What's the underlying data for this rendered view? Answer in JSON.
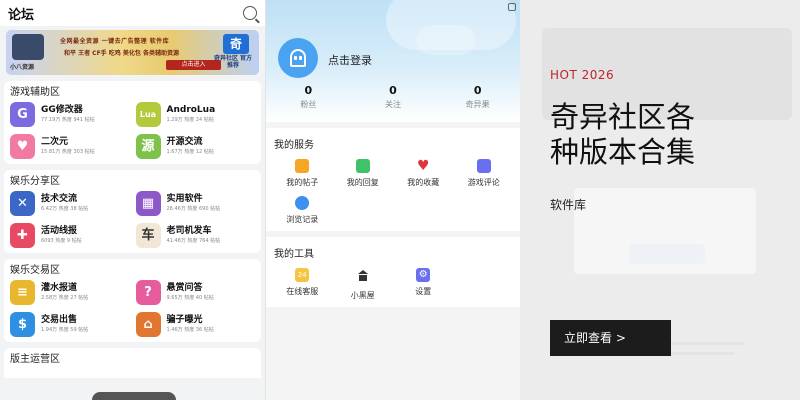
{
  "forum": {
    "title": "论坛",
    "banner": {
      "left_caption": "小八资源",
      "mid_line1": "全网最全资源  一键去广告整理  软件库",
      "mid_line2": "和平  王者  CF手  吃鸡  美化包  各类辅助资源",
      "button": "点击进入",
      "right_logo": "奇",
      "right_caption": "奇异社区 官方推荐"
    },
    "sections": [
      {
        "title": "游戏辅助区",
        "items": [
          {
            "name": "GG修改器",
            "stats": "77.19万 热度  941 帖帖",
            "color": "#7b6be0",
            "glyph": "G"
          },
          {
            "name": "AndroLua",
            "stats": "1.29万 热度  24 帖帖",
            "color": "#b4c93c",
            "glyph": "Lua"
          },
          {
            "name": "二次元",
            "stats": "15.81万 热度  303 帖帖",
            "color": "#f27aa2",
            "glyph": "♥"
          },
          {
            "name": "开源交流",
            "stats": "1.67万 热度  12 帖帖",
            "color": "#7dc24a",
            "glyph": "源"
          }
        ]
      },
      {
        "title": "娱乐分享区",
        "items": [
          {
            "name": "技术交流",
            "stats": "6.42万 热度  38 帖帖",
            "color": "#3b67c7",
            "glyph": "✕"
          },
          {
            "name": "实用软件",
            "stats": "28.46万 热度  690 帖帖",
            "color": "#8d58c8",
            "glyph": "▦"
          },
          {
            "name": "活动线报",
            "stats": "6093 热度  9 帖帖",
            "color": "#e84a64",
            "glyph": "✚"
          },
          {
            "name": "老司机发车",
            "stats": "41.48万 热度  764 帖帖",
            "color": "#f2e6d6",
            "glyph": "车"
          }
        ]
      },
      {
        "title": "娱乐交易区",
        "items": [
          {
            "name": "灌水报道",
            "stats": "2.58万 热度  27 帖帖",
            "color": "#e8b72e",
            "glyph": "≡"
          },
          {
            "name": "悬赏问答",
            "stats": "9.65万 热度  40 帖帖",
            "color": "#e65c9c",
            "glyph": "?"
          },
          {
            "name": "交易出售",
            "stats": "1.94万 热度  59 帖帖",
            "color": "#2f8fe0",
            "glyph": "$"
          },
          {
            "name": "骗子曝光",
            "stats": "1.46万 热度  36 帖帖",
            "color": "#e0762f",
            "glyph": "⌂"
          }
        ]
      }
    ],
    "last_section": "版主运营区"
  },
  "profile": {
    "login": "点击登录",
    "stats": [
      {
        "value": "0",
        "label": "粉丝"
      },
      {
        "value": "0",
        "label": "关注"
      },
      {
        "value": "0",
        "label": "奇异果"
      }
    ],
    "services_title": "我的服务",
    "services": [
      {
        "label": "我的帖子",
        "color": "#f5a623"
      },
      {
        "label": "我的回复",
        "color": "#3ec36a"
      },
      {
        "label": "我的收藏",
        "color": "#e0353a"
      },
      {
        "label": "游戏评论",
        "color": "#6a6ff0"
      },
      {
        "label": "浏览记录",
        "color": "#3d8ff0"
      }
    ],
    "tools_title": "我的工具",
    "tools": [
      {
        "label": "在线客服",
        "color": "#f5c542",
        "glyph": "24"
      },
      {
        "label": "小黑屋",
        "color": "#333333",
        "glyph": ""
      },
      {
        "label": "设置",
        "color": "#6a6ff0",
        "glyph": "⚙"
      }
    ]
  },
  "promo": {
    "hot": "HOT 2026",
    "headline": "奇异社区各种版本合集",
    "subhead": "软件库",
    "cta": "立即查看 >",
    "accent": "#c0232b"
  }
}
